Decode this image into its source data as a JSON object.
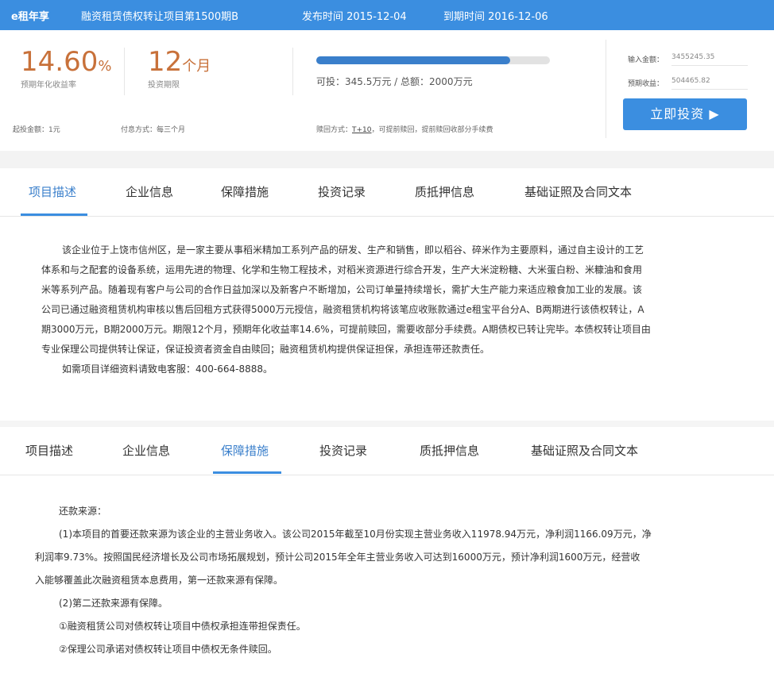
{
  "header": {
    "brand": "e租年享",
    "project": "融资租赁债权转让项目第1500期B",
    "publish": "发布时间 2015-12-04",
    "expire": "到期时间 2016-12-06"
  },
  "summary": {
    "rate_value": "14.60",
    "rate_unit": "%",
    "rate_label": "预期年化收益率",
    "term_value": "12",
    "term_unit": "个月",
    "term_label": "投资期限",
    "progress_fraction": 0.83,
    "progress_text": "可投：345.5万元 / 总额：2000万元",
    "input_label": "输入金额：",
    "input_value": "3455245.35",
    "expect_label": "预期收益：",
    "expect_value": "504465.82",
    "min_invest": "起投金额：1元",
    "interest_method": "付息方式：每三个月",
    "redeem_label": "赎回方式：",
    "redeem_link": "T+10",
    "redeem_note": "，可提前赎回，提前赎回收部分手续费",
    "invest_button": "立即投资 ▶"
  },
  "tabs1": {
    "items": [
      "项目描述",
      "企业信息",
      "保障措施",
      "投资记录",
      "质抵押信息",
      "基础证照及合同文本"
    ],
    "active_index": 0
  },
  "description": {
    "lines": [
      "该企业位于上饶市信州区，是一家主要从事稻米精加工系列产品的研发、生产和销售，即以稻谷、碎米作为主要原料，通过自主设计的工艺",
      "体系和与之配套的设备系统，运用先进的物理、化学和生物工程技术，对稻米资源进行综合开发，生产大米淀粉糖、大米蛋白粉、米糠油和食用",
      "米等系列产品。随着现有客户与公司的合作日益加深以及新客户不断增加，公司订单量持续增长，需扩大生产能力来适应粮食加工业的发展。该",
      "公司已通过融资租赁机构审核以售后回租方式获得5000万元授信，融资租赁机构将该笔应收账款通过e租宝平台分A、B两期进行该债权转让，A",
      "期3000万元，B期2000万元。期限12个月，预期年化收益率14.6%，可提前赎回，需要收部分手续费。A期债权已转让完毕。本债权转让项目由",
      "专业保理公司提供转让保证，保证投资者资金自由赎回；融资租赁机构提供保证担保，承担连带还款责任。",
      "如需项目详细资料请致电客服：400-664-8888。"
    ]
  },
  "tabs2": {
    "items": [
      "项目描述",
      "企业信息",
      "保障措施",
      "投资记录",
      "质抵押信息",
      "基础证照及合同文本"
    ],
    "active_index": 2
  },
  "guarantee": {
    "lines": [
      "还款来源：",
      "(1)本项目的首要还款来源为该企业的主营业务收入。该公司2015年截至10月份实现主营业务收入11978.94万元，净利润1166.09万元，净",
      "利润率9.73%。按照国民经济增长及公司市场拓展规划，预计公司2015年全年主营业务收入可达到16000万元，预计净利润1600万元，经营收",
      "入能够覆盖此次融资租赁本息费用，第一还款来源有保障。",
      "(2)第二还款来源有保障。",
      "①融资租赁公司对债权转让项目中债权承担连带担保责任。",
      "②保理公司承诺对债权转让项目中债权无条件赎回。"
    ]
  },
  "colors": {
    "accent": "#3b8ee0",
    "rate": "#c8713a"
  }
}
